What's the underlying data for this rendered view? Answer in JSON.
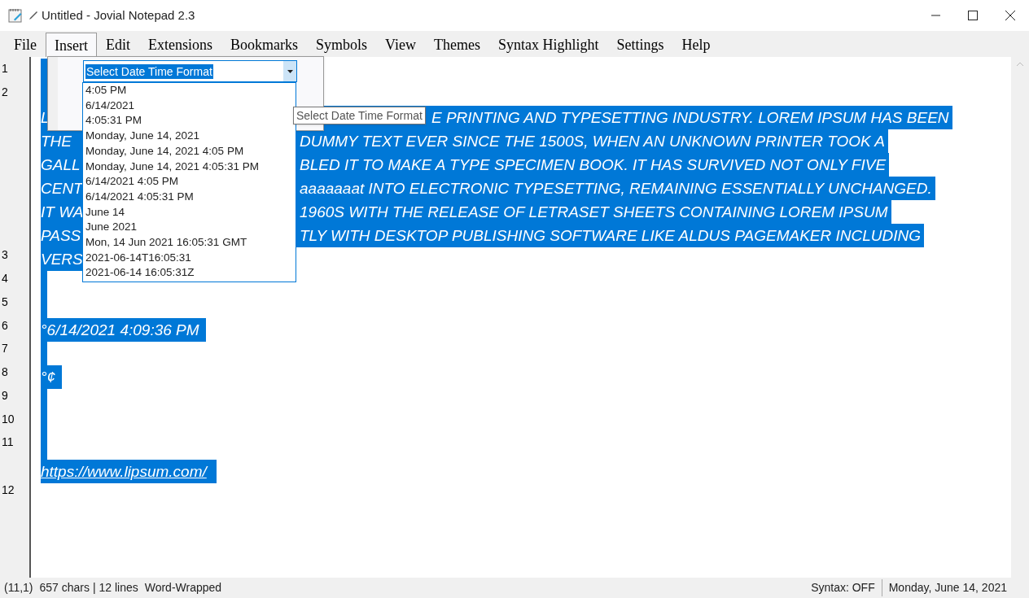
{
  "window": {
    "title": "Untitled - Jovial Notepad 2.3"
  },
  "menu": [
    {
      "label": "File",
      "open": false
    },
    {
      "label": "Insert",
      "open": true
    },
    {
      "label": "Edit",
      "open": false
    },
    {
      "label": "Extensions",
      "open": false
    },
    {
      "label": "Bookmarks",
      "open": false
    },
    {
      "label": "Symbols",
      "open": false
    },
    {
      "label": "View",
      "open": false
    },
    {
      "label": "Themes",
      "open": false
    },
    {
      "label": "Syntax Highlight",
      "open": false
    },
    {
      "label": "Settings",
      "open": false
    },
    {
      "label": "Help",
      "open": false
    }
  ],
  "editor": {
    "line_numbers": [
      "1",
      "2",
      "3",
      "4",
      "5",
      "6",
      "7",
      "8",
      "9",
      "10",
      "11",
      "12"
    ],
    "rows": [
      {
        "kind": "blank"
      },
      {
        "kind": "blank"
      },
      {
        "kind": "split_tooltip",
        "left": "L",
        "right": "E PRINTING AND TYPESETTING INDUSTRY. LOREM IPSUM HAS BEEN"
      },
      {
        "kind": "split",
        "left": "THE",
        "right": "DUMMY TEXT EVER SINCE THE 1500S, WHEN AN UNKNOWN PRINTER TOOK A"
      },
      {
        "kind": "split",
        "left": "GALL",
        "right": "BLED IT TO MAKE A TYPE SPECIMEN BOOK. IT HAS SURVIVED NOT ONLY FIVE"
      },
      {
        "kind": "split",
        "left": "CENT",
        "right": "aaaaaaat INTO ELECTRONIC TYPESETTING, REMAINING ESSENTIALLY UNCHANGED."
      },
      {
        "kind": "split",
        "left": "IT WA",
        "right": "1960S WITH THE RELEASE OF LETRASET SHEETS CONTAINING LOREM IPSUM"
      },
      {
        "kind": "split",
        "left": "PASS",
        "right": "TLY WITH DESKTOP PUBLISHING SOFTWARE LIKE ALDUS PAGEMAKER INCLUDING"
      },
      {
        "kind": "text",
        "text": "VERS"
      },
      {
        "kind": "blank"
      },
      {
        "kind": "blank"
      },
      {
        "kind": "text",
        "text": "°6/14/2021 4:09:36 PM"
      },
      {
        "kind": "blank"
      },
      {
        "kind": "text",
        "text": "°¢"
      },
      {
        "kind": "blank"
      },
      {
        "kind": "blank"
      },
      {
        "kind": "blank"
      },
      {
        "kind": "link",
        "text": "https://www.lipsum.com/"
      }
    ]
  },
  "insert_menu": {
    "combo": {
      "value": "Select Date Time Format"
    },
    "options": [
      "4:05 PM",
      "6/14/2021",
      "4:05:31 PM",
      "Monday, June 14, 2021",
      "Monday, June 14, 2021 4:05 PM",
      "Monday, June 14, 2021 4:05:31 PM",
      "6/14/2021 4:05 PM",
      "6/14/2021 4:05:31 PM",
      "June 14",
      "June 2021",
      "Mon, 14 Jun 2021 16:05:31 GMT",
      "2021-06-14T16:05:31",
      "2021-06-14 16:05:31Z"
    ],
    "tooltip": "Select Date Time Format"
  },
  "status_bar": {
    "position": "(11,1)",
    "counts": "657 chars | 12 lines",
    "wrap": "Word-Wrapped",
    "syntax": "Syntax: OFF",
    "date": "Monday, June 14, 2021"
  }
}
